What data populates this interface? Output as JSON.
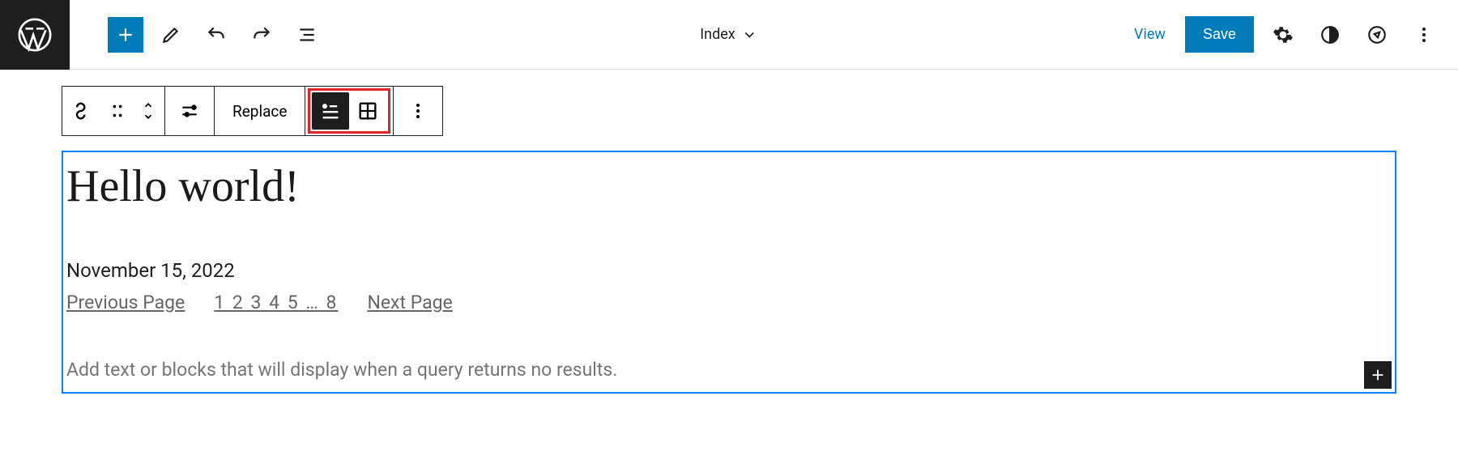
{
  "header": {
    "document_title": "Index",
    "view_label": "View",
    "save_label": "Save"
  },
  "block_toolbar": {
    "replace_label": "Replace"
  },
  "post": {
    "title": "Hello world!",
    "date": "November 15, 2022"
  },
  "pagination": {
    "previous": "Previous Page",
    "numbers": "1 2 3 4 5 … 8",
    "next": "Next Page"
  },
  "no_results_placeholder": "Add text or blocks that will display when a query returns no results."
}
